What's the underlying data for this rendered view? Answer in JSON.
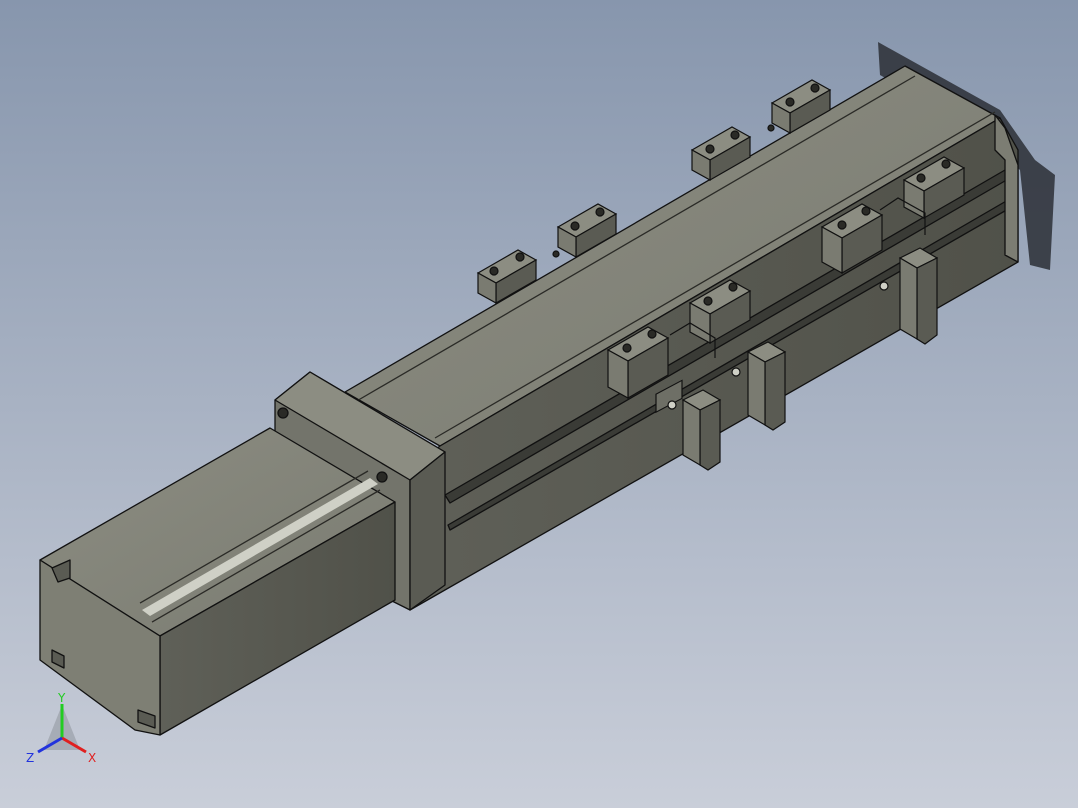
{
  "viewport": {
    "background_top": "#8796ad",
    "background_bottom": "#c9ced9"
  },
  "model": {
    "body_color": "#6e6f66",
    "face_light": "#8b8c80",
    "face_dark": "#55564f",
    "edge_color": "#111111",
    "highlight": "#cfd0c6"
  },
  "triad": {
    "x_label": "X",
    "y_label": "Y",
    "z_label": "Z",
    "x_color": "#e02020",
    "y_color": "#22cc22",
    "z_color": "#2233dd"
  }
}
